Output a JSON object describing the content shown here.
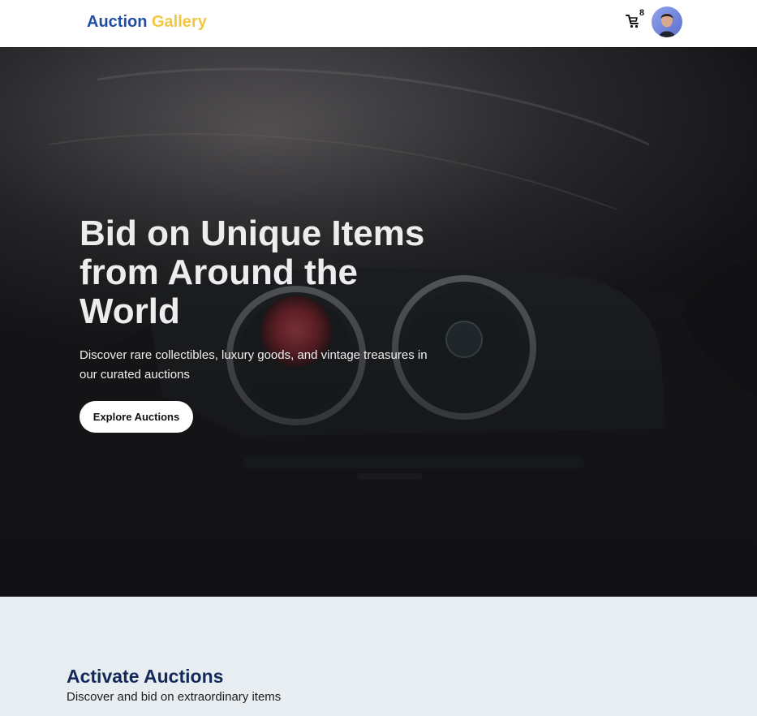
{
  "header": {
    "brand_part1": "Auction",
    "brand_part2": "Gallery",
    "cart_count": "8",
    "cart_icon": "cart-icon",
    "avatar_icon": "user-avatar"
  },
  "hero": {
    "title": "Bid on Unique Items from Around the World",
    "subtitle": "Discover rare collectibles, luxury goods, and vintage treasures in our curated auctions",
    "cta_label": "Explore Auctions"
  },
  "auctions": {
    "title": "Activate Auctions",
    "subtitle": "Discover and bid on extraordinary items"
  },
  "colors": {
    "brand_blue": "#1f4ea3",
    "brand_yellow": "#f2c744",
    "section_bg": "#e8edf2",
    "section_title": "#12295a"
  }
}
